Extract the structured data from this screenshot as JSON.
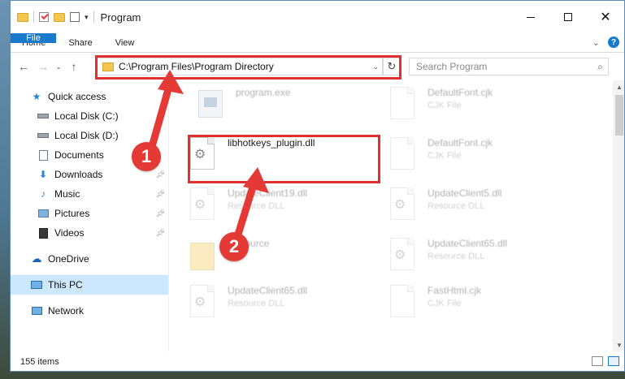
{
  "window": {
    "title": "Program",
    "minimize_glyph": "—",
    "maximize_glyph": "☐",
    "close_glyph": "✕"
  },
  "ribbon": {
    "tabs": [
      "File",
      "Home",
      "Share",
      "View"
    ],
    "expand_icon": "chevron-down-icon",
    "help_label": "?"
  },
  "address": {
    "path": "C:\\Program Files\\Program Directory",
    "refresh_glyph": "↻",
    "search_placeholder": "Search Program"
  },
  "nav": {
    "quick_access": "Quick access",
    "items": [
      {
        "label": "Local Disk (C:)",
        "icon": "drive-icon",
        "pinned": false
      },
      {
        "label": "Local Disk (D:)",
        "icon": "drive-icon",
        "pinned": false
      },
      {
        "label": "Documents",
        "icon": "documents-icon",
        "pinned": false
      },
      {
        "label": "Downloads",
        "icon": "downloads-icon",
        "pinned": true
      },
      {
        "label": "Music",
        "icon": "music-icon",
        "pinned": true
      },
      {
        "label": "Pictures",
        "icon": "pictures-icon",
        "pinned": true
      },
      {
        "label": "Videos",
        "icon": "videos-icon",
        "pinned": true
      }
    ],
    "onedrive": "OneDrive",
    "this_pc": "This PC",
    "network": "Network"
  },
  "files": {
    "program_exe": {
      "name": "program.exe",
      "type": ""
    },
    "defaultfont_1": {
      "name": "DefaultFont.cjk",
      "type": "CJK File"
    },
    "libhotkeys": {
      "name": "libhotkeys_plugin.dll",
      "type": ""
    },
    "defaultfont_2": {
      "name": "DefaultFont.cjk",
      "type": "CJK File"
    },
    "updateclient19": {
      "name": "UpdateClient19.dll",
      "type": "Resource DLL"
    },
    "updateclient5": {
      "name": "UpdateClient5.dll",
      "type": "Resource DLL"
    },
    "resource_folder": {
      "name": "Resource",
      "type": ""
    },
    "updateclient65_a": {
      "name": "UpdateClient65.dll",
      "type": "Resource DLL"
    },
    "updateclient65_b": {
      "name": "UpdateClient65.dll",
      "type": "Resource DLL"
    },
    "fasthtml": {
      "name": "FastHtml.cjk",
      "type": "CJK File"
    }
  },
  "status": {
    "item_count": "155 items"
  },
  "callouts": {
    "one": "1",
    "two": "2",
    "color": "#e53935"
  }
}
